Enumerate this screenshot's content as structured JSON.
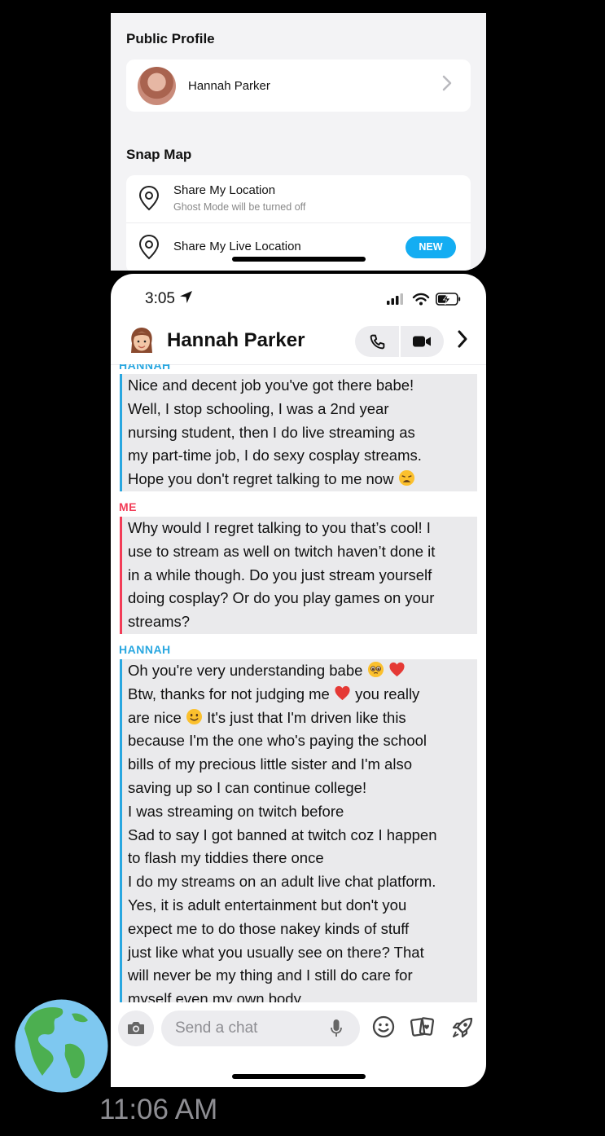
{
  "settings": {
    "public_profile_title": "Public Profile",
    "profile_name": "Hannah Parker",
    "snap_map_title": "Snap Map",
    "share_location_title": "Share My Location",
    "share_location_sub": "Ghost Mode will be turned off",
    "share_live_title": "Share My Live Location",
    "new_badge": "NEW"
  },
  "status_bar": {
    "time": "3:05"
  },
  "chat": {
    "contact_name": "Hannah Parker",
    "cut_off_label": "HANNAH",
    "messages": [
      {
        "sender": "HANNAH",
        "lines": [
          "Nice and decent job you've got there babe!",
          "Well, I stop schooling, I was a 2nd year",
          "nursing student, then I do live streaming as",
          "my part-time job, I do sexy cosplay streams.",
          "Hope you don't regret talking to me now"
        ]
      },
      {
        "sender": "ME",
        "lines": [
          "Why would I regret talking to you that’s cool! I",
          "use to stream as well on twitch haven’t done it",
          "in a while though. Do you just stream yourself",
          "doing cosplay? Or do you play games on your",
          "streams?"
        ]
      },
      {
        "sender": "HANNAH",
        "lines": [
          "Oh you're very understanding babe",
          "Btw, thanks for not judging me",
          "you really",
          "are nice",
          "It's just that I'm driven like this",
          "because I'm the one who's paying the school",
          "bills of my precious little sister and I'm also",
          "saving up so I can continue college!",
          "I was streaming on twitch before",
          "Sad to say I got banned at twitch coz I happen",
          "to flash my tiddies there once",
          "I do my streams on an adult live chat platform.",
          "Yes, it is adult entertainment but don't you",
          "expect me to do those nakey kinds of stuff",
          "just like what you usually see on there? That",
          "will never be my thing and I still do care for",
          "myself even my own body"
        ]
      }
    ],
    "composer_placeholder": "Send a chat"
  },
  "icons": {
    "location_arrow": "location-arrow-icon",
    "phone": "phone-icon",
    "video": "video-icon",
    "camera": "camera-icon",
    "mic": "microphone-icon",
    "emoji": "smiley-icon",
    "cards": "cards-icon",
    "rocket": "rocket-icon",
    "globe": "globe-emoji"
  },
  "colors": {
    "hannah": "#29a7e0",
    "me": "#f23c57",
    "badge": "#14adf2"
  },
  "footer": {
    "time": "11:06 AM"
  }
}
